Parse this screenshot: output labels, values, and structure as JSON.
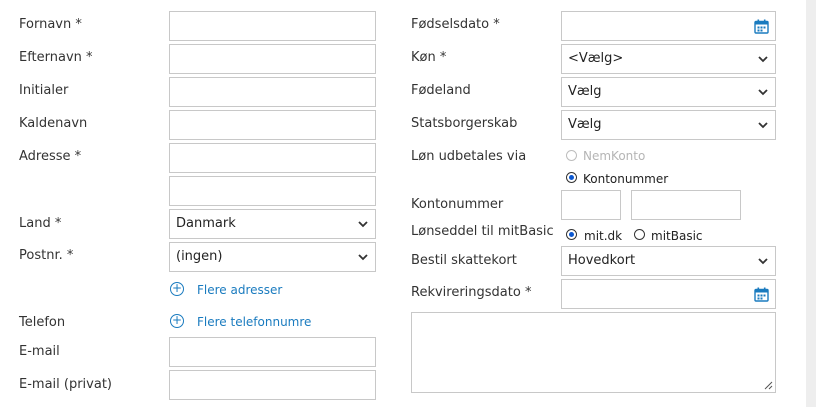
{
  "colors": {
    "link": "#1a7bbf",
    "border": "#c8c8c8",
    "radio_selected": "#0b57d0"
  },
  "left": {
    "fornavn": {
      "label": "Fornavn *",
      "value": ""
    },
    "efternavn": {
      "label": "Efternavn *",
      "value": ""
    },
    "initialer": {
      "label": "Initialer",
      "value": ""
    },
    "kaldenavn": {
      "label": "Kaldenavn",
      "value": ""
    },
    "adresse": {
      "label": "Adresse *",
      "value": "",
      "value2": ""
    },
    "land": {
      "label": "Land *",
      "value": "Danmark"
    },
    "postnr": {
      "label": "Postnr. *",
      "value": "(ingen)"
    },
    "flere_adresser": {
      "icon": "plus-circle-icon",
      "label": "Flere adresser"
    },
    "telefon": {
      "label": "Telefon",
      "link_label": "Flere telefonnumre",
      "icon": "plus-circle-icon"
    },
    "email": {
      "label": "E-mail",
      "value": ""
    },
    "email_privat": {
      "label": "E-mail (privat)",
      "value": ""
    }
  },
  "right": {
    "foedselsdato": {
      "label": "Fødselsdato *",
      "value": "",
      "icon": "calendar-icon"
    },
    "koen": {
      "label": "Køn *",
      "value": "<Vælg>"
    },
    "foedeland": {
      "label": "Fødeland",
      "value": "Vælg"
    },
    "statsborgerskab": {
      "label": "Statsborgerskab",
      "value": "Vælg"
    },
    "loen_udbetales": {
      "label": "Løn udbetales via",
      "options": [
        {
          "label": "NemKonto",
          "selected": false,
          "disabled": true
        },
        {
          "label": "Kontonummer",
          "selected": true,
          "disabled": false
        }
      ]
    },
    "kontonummer": {
      "label": "Kontonummer",
      "reg": "",
      "konto": ""
    },
    "loenseddel": {
      "label": "Lønseddel til mitBasic",
      "options": [
        {
          "label": "mit.dk",
          "selected": true
        },
        {
          "label": "mitBasic",
          "selected": false
        }
      ]
    },
    "skattekort": {
      "label": "Bestil skattekort",
      "value": "Hovedkort"
    },
    "rekvireringsdato": {
      "label": "Rekvireringsdato *",
      "value": "",
      "icon": "calendar-icon"
    },
    "notes": {
      "value": ""
    }
  }
}
